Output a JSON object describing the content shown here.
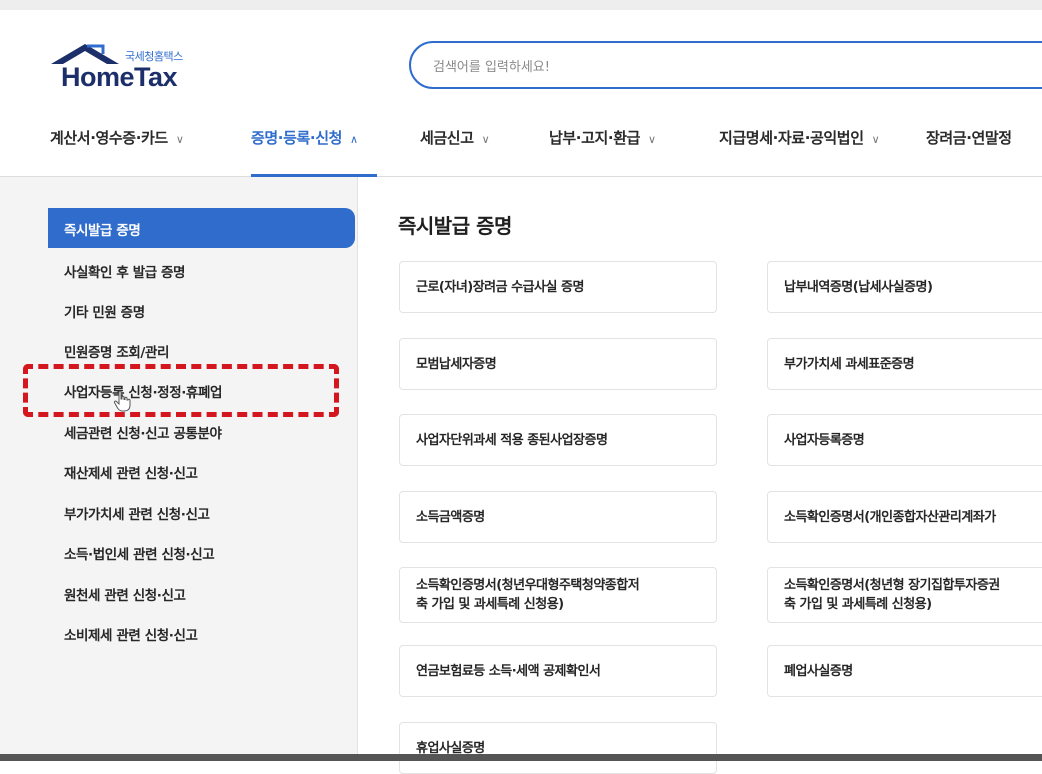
{
  "logo": {
    "subtitle": "국세청홈택스",
    "title": "HomeTax"
  },
  "search": {
    "placeholder": "검색어를 입력하세요!"
  },
  "topnav": [
    {
      "label": "계산서·영수증·카드",
      "active": false
    },
    {
      "label": "증명·등록·신청",
      "active": true
    },
    {
      "label": "세금신고",
      "active": false
    },
    {
      "label": "납부·고지·환급",
      "active": false
    },
    {
      "label": "지급명세·자료·공익법인",
      "active": false
    },
    {
      "label": "장려금·연말정",
      "active": false
    }
  ],
  "sidebar": {
    "items": [
      {
        "label": "즉시발급 증명",
        "active": true
      },
      {
        "label": "사실확인 후 발급 증명"
      },
      {
        "label": "기타 민원 증명"
      },
      {
        "label": "민원증명 조회/관리"
      },
      {
        "label": "사업자등록 신청·정정·휴폐업",
        "highlighted": true
      },
      {
        "label": "세금관련 신청·신고 공통분야"
      },
      {
        "label": "재산제세 관련 신청·신고"
      },
      {
        "label": "부가가치세 관련 신청·신고"
      },
      {
        "label": "소득·법인세 관련 신청·신고"
      },
      {
        "label": "원천세 관련 신청·신고"
      },
      {
        "label": "소비제세 관련 신청·신고"
      }
    ]
  },
  "main": {
    "title": "즉시발급 증명",
    "cards": [
      "근로(자녀)장려금 수급사실 증명",
      "납부내역증명(납세사실증명)",
      "모범납세자증명",
      "부가가치세 과세표준증명",
      "사업자단위과세 적용 종된사업장증명",
      "사업자등록증명",
      "소득금액증명",
      "소득확인증명서(개인종합자산관리계좌가",
      "소득확인증명서(청년우대형주택청약종합저\n축 가입 및 과세특례 신청용)",
      "소득확인증명서(청년형 장기집합투자증권\n축 가입 및 과세특례 신청용)",
      "연금보험료등 소득·세액 공제확인서",
      "폐업사실증명",
      "휴업사실증명"
    ]
  },
  "colors": {
    "accent": "#2f6ccc",
    "highlight_border": "#d4171f",
    "sidebar_bg": "#f4f4f4"
  },
  "icons": {
    "logo": "house-roof-icon",
    "chevron_down": "chevron-down-icon",
    "chevron_up": "chevron-up-icon",
    "cursor": "hand-pointer-cursor-icon"
  }
}
